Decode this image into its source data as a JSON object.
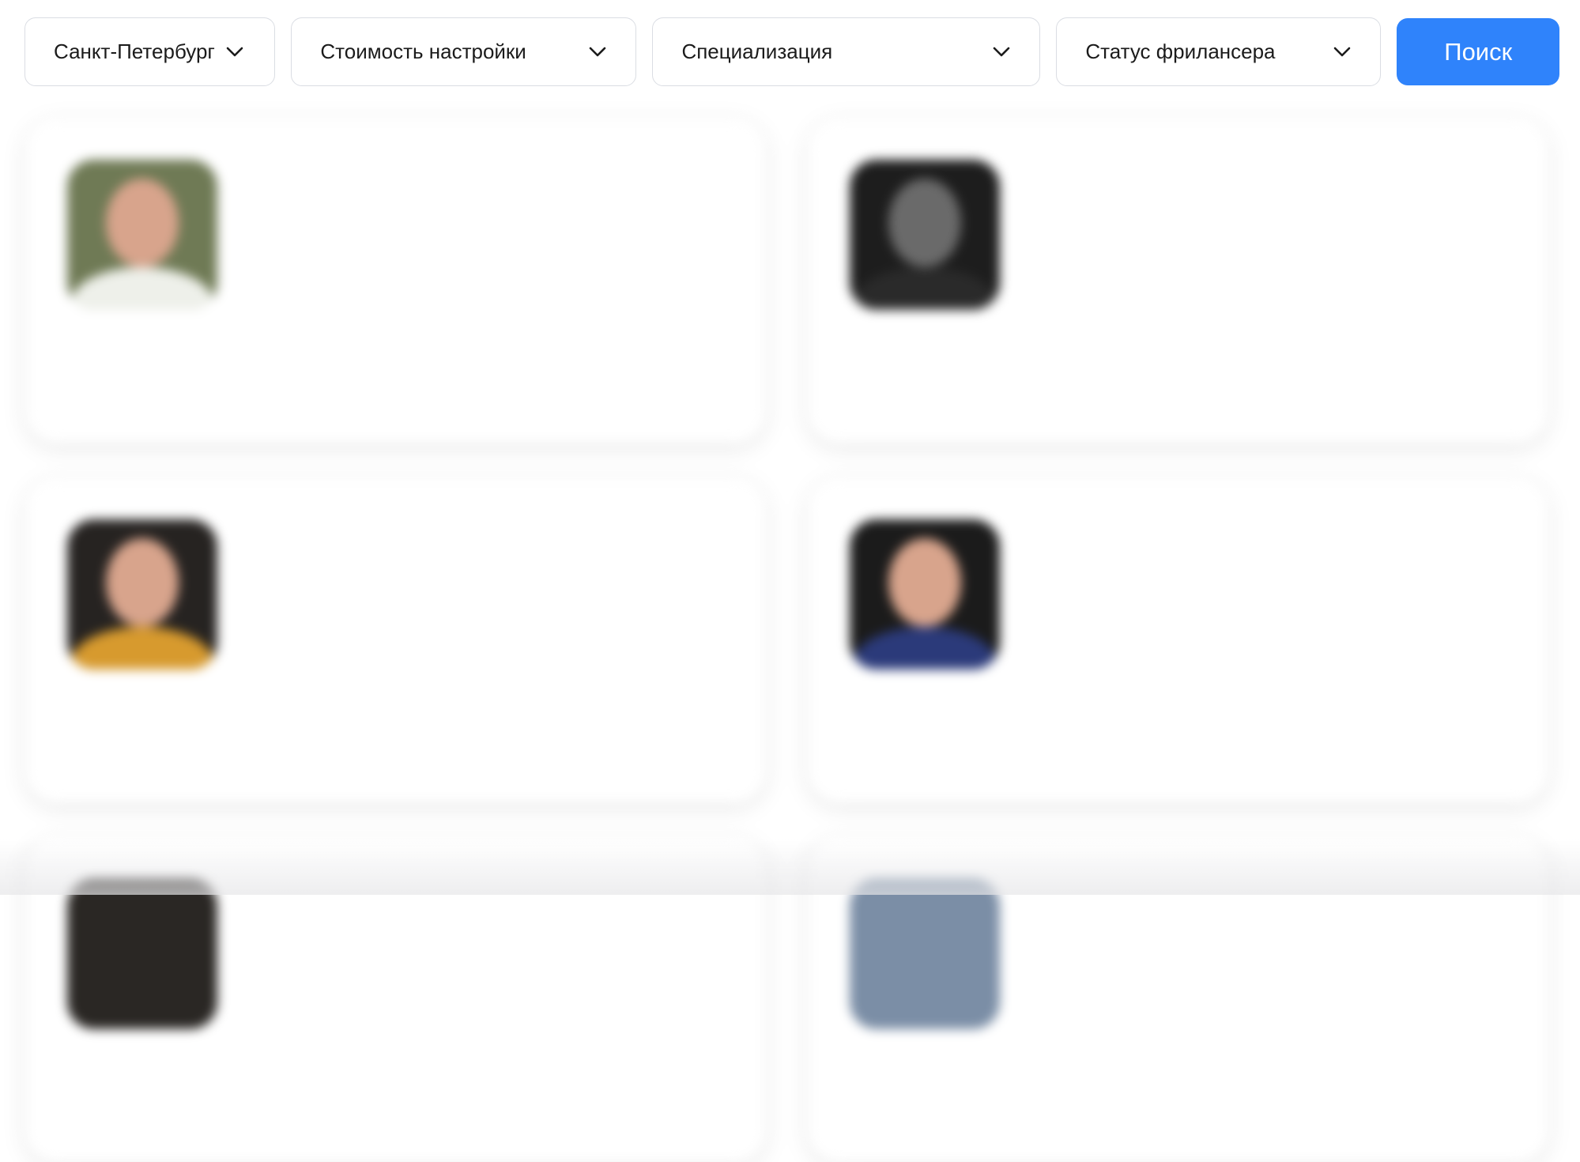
{
  "filters": {
    "city": {
      "value": "Санкт-Петербург",
      "icon": "chevron-down-icon"
    },
    "cost": {
      "value": "Стоимость настройки",
      "icon": "chevron-down-icon"
    },
    "specialization": {
      "value": "Специализация",
      "icon": "chevron-down-icon"
    },
    "status": {
      "value": "Статус фрилансера",
      "icon": "chevron-down-icon"
    },
    "search_label": "Поиск"
  },
  "colors": {
    "accent": "#2f83fb",
    "border": "#dadde3",
    "text": "#1b1b1b"
  },
  "freelancers": [
    {
      "name": "",
      "description": "",
      "city": "",
      "price": "",
      "avatar_bg": "#6f7a55",
      "shoulders": "#eef0ea"
    },
    {
      "name": "",
      "description": "",
      "city": "",
      "price": "",
      "avatar_bg": "#1d1d1d",
      "shoulders": "#2a2a2a"
    },
    {
      "name": "",
      "description": "",
      "city": "",
      "price": "",
      "avatar_bg": "#262321",
      "shoulders": "#d79a2e"
    },
    {
      "name": "",
      "description": "",
      "city": "",
      "price": "",
      "avatar_bg": "#1b1b1b",
      "shoulders": "#2b3a7a"
    }
  ]
}
